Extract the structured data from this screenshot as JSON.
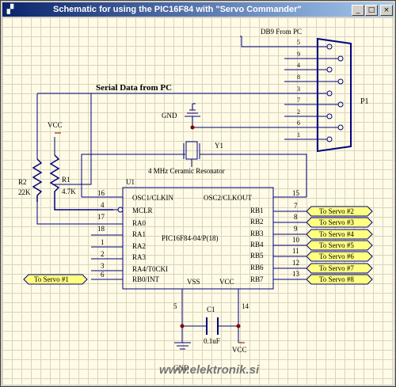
{
  "window": {
    "title": "Schematic for using the PIC16F84 with \"Servo Commander\"",
    "minimize_glyph": "_",
    "maximize_glyph": "□",
    "close_glyph": "×"
  },
  "connector": {
    "label": "DB9 From PC",
    "ref": "P1",
    "pins": [
      "5",
      "9",
      "4",
      "8",
      "3",
      "7",
      "2",
      "6",
      "1"
    ]
  },
  "serial_label": "Serial Data from PC",
  "gnd_top": "GND",
  "vcc_left": "VCC",
  "resonator": {
    "ref": "Y1",
    "label": "4 MHz Ceramic Resonator"
  },
  "resistors": {
    "r2": {
      "ref": "R2",
      "value": "22K"
    },
    "r1": {
      "ref": "R1",
      "value": "4.7K"
    }
  },
  "ic": {
    "ref": "U1",
    "name": "PIC16F84-04/P(18)",
    "left_pins": [
      {
        "num": "16",
        "label": "OSC1/CLKIN"
      },
      {
        "num": "4",
        "label": "MCLR"
      },
      {
        "num": "17",
        "label": "RA0"
      },
      {
        "num": "18",
        "label": "RA1"
      },
      {
        "num": "1",
        "label": "RA2"
      },
      {
        "num": "2",
        "label": "RA3"
      },
      {
        "num": "3",
        "label": "RA4/T0CKI"
      },
      {
        "num": "6",
        "label": "RB0/INT"
      }
    ],
    "right_pins": [
      {
        "num": "15",
        "label": "OSC2/CLKOUT"
      },
      {
        "num": "7",
        "label": "RB1"
      },
      {
        "num": "8",
        "label": "RB2"
      },
      {
        "num": "9",
        "label": "RB3"
      },
      {
        "num": "10",
        "label": "RB4"
      },
      {
        "num": "11",
        "label": "RB5"
      },
      {
        "num": "12",
        "label": "RB6"
      },
      {
        "num": "13",
        "label": "RB7"
      }
    ],
    "vss": {
      "num": "5",
      "label": "VSS"
    },
    "vcc": {
      "num": "14",
      "label": "VCC"
    }
  },
  "servo_out": [
    "To Servo #2",
    "To Servo #3",
    "To Servo #4",
    "To Servo #5",
    "To Servo #6",
    "To Servo #7",
    "To Servo #8"
  ],
  "servo_in": "To Servo #1",
  "capacitor": {
    "ref": "C1",
    "value": "0.1uF"
  },
  "gnd_bottom": "GND",
  "vcc_bottom": "VCC",
  "watermark": "www.elektronik.si",
  "colors": {
    "wire": "#000080",
    "title_start": "#0a246a",
    "title_end": "#a6caf0",
    "port_fill": "#ffff80",
    "power": "#800000",
    "canvas": "#fffbe6"
  }
}
